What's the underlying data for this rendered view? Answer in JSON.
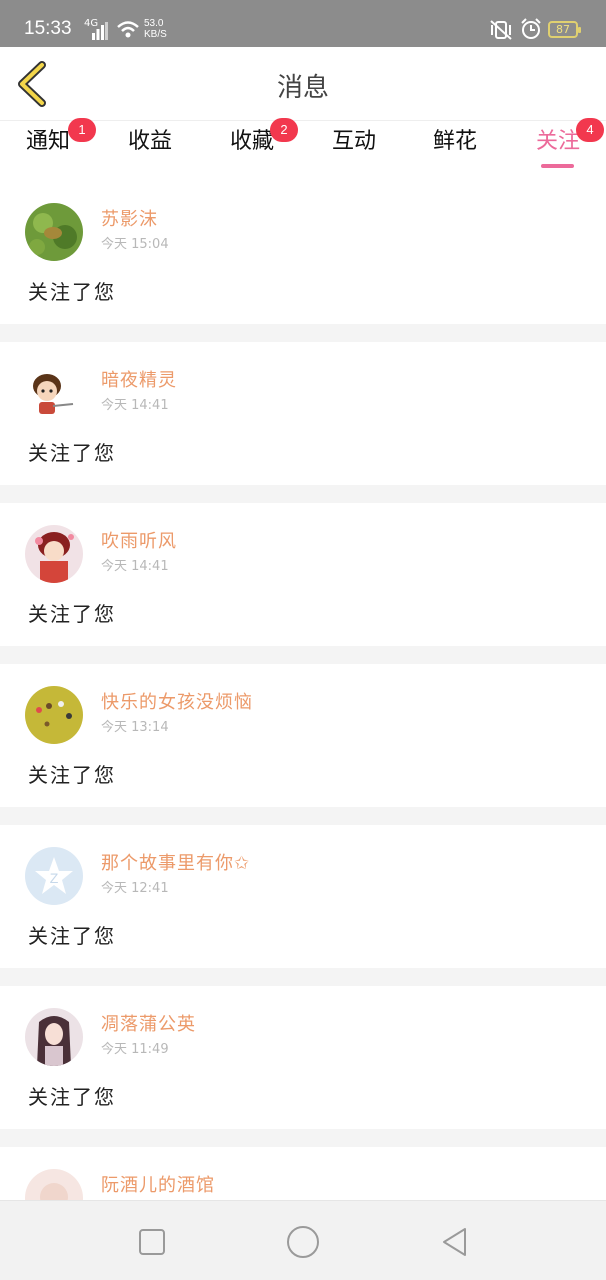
{
  "status_bar": {
    "time": "15:33",
    "network": "4G",
    "speed_value": "53.0",
    "speed_unit": "KB/S",
    "battery": "87",
    "icons": [
      "signal-icon",
      "wifi-icon",
      "vibrate-off-icon",
      "alarm-icon",
      "battery-icon"
    ]
  },
  "header": {
    "title": "消息",
    "back_icon": "chevron-left-icon"
  },
  "tabs": [
    {
      "label": "通知",
      "badge": "1"
    },
    {
      "label": "收益",
      "badge": ""
    },
    {
      "label": "收藏",
      "badge": "2"
    },
    {
      "label": "互动",
      "badge": ""
    },
    {
      "label": "鲜花",
      "badge": ""
    },
    {
      "label": "关注",
      "badge": "4",
      "active": true
    }
  ],
  "messages": [
    {
      "name": "苏影沫",
      "time": "今天 15:04",
      "text": "关注了您"
    },
    {
      "name": "暗夜精灵",
      "time": "今天 14:41",
      "text": "关注了您"
    },
    {
      "name": "吹雨听风",
      "time": "今天 14:41",
      "text": "关注了您"
    },
    {
      "name": "快乐的女孩没烦恼",
      "time": "今天 13:14",
      "text": "关注了您"
    },
    {
      "name": "那个故事里有你✩",
      "time": "今天 12:41",
      "text": "关注了您"
    },
    {
      "name": "凋落蒲公英",
      "time": "今天 11:49",
      "text": "关注了您"
    },
    {
      "name": "阮酒儿的酒馆",
      "time": "",
      "text": ""
    }
  ],
  "nav": {
    "icons": [
      "recent-apps-icon",
      "home-icon",
      "back-icon"
    ]
  },
  "colors": {
    "accent": "#ec6a9a",
    "name": "#ec9a6a",
    "badge": "#f2384e"
  }
}
